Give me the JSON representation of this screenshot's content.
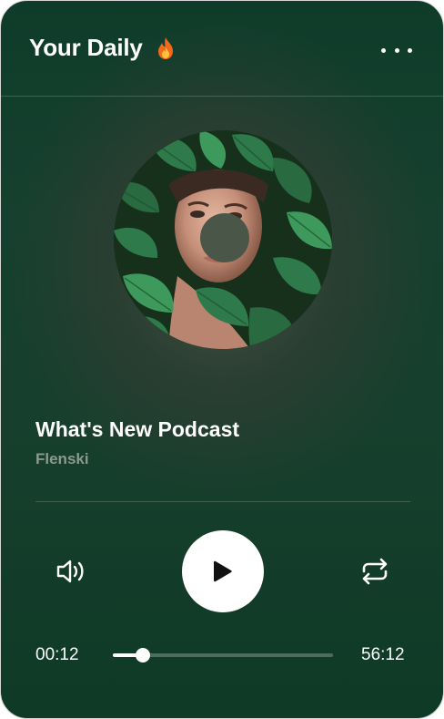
{
  "header": {
    "title": "Your Daily",
    "title_icon": "fire-icon",
    "menu_icon": "more-horizontal-icon"
  },
  "album_art": {
    "description_icon": "album-art-image"
  },
  "track": {
    "title": "What's New Podcast",
    "artist": "Flenski"
  },
  "controls": {
    "volume_icon": "volume-icon",
    "play_icon": "play-icon",
    "repeat_icon": "repeat-icon"
  },
  "progress": {
    "current_time": "00:12",
    "total_time": "56:12",
    "fraction": 0.135
  },
  "colors": {
    "background": "#16402f",
    "accent": "#ffffff",
    "muted_text": "#8a9a8c"
  }
}
